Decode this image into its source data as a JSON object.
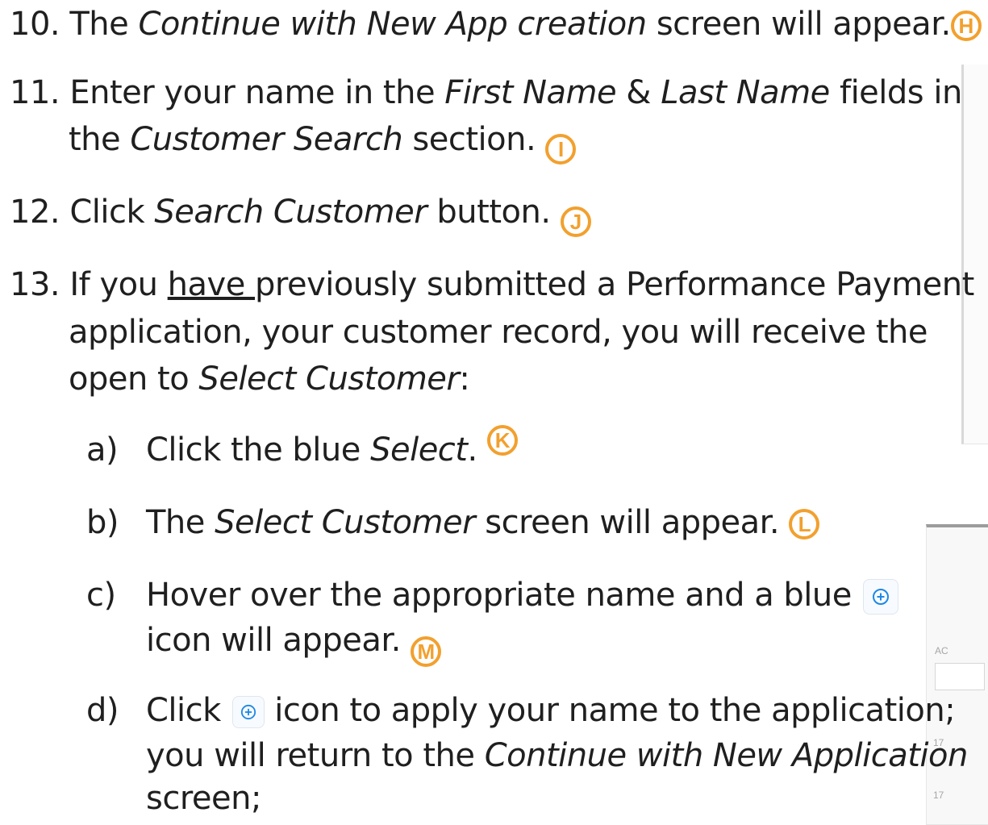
{
  "instructions": {
    "step10": {
      "number": "10.",
      "pre": "The ",
      "italic": "Continue with New App creation",
      "post": " screen will appear.",
      "marker": "H"
    },
    "step11": {
      "number": "11.",
      "line1_pre": "Enter your name in the ",
      "line1_italic1": "First Name",
      "line1_mid": " & ",
      "line1_italic2": "Last Name",
      "line1_post": " fields in",
      "line2_pre": "the ",
      "line2_italic": "Customer Search",
      "line2_post": " section.",
      "marker": "I"
    },
    "step12": {
      "number": "12.",
      "pre": "Click ",
      "italic": "Search Customer",
      "post": " button.",
      "marker": "J"
    },
    "step13": {
      "number": "13.",
      "line1_pre": "If you ",
      "line1_underline": "have ",
      "line1_post": "previously submitted a Performance Payment",
      "line2": "application, your customer record, you will receive the",
      "line3_pre": "open to ",
      "line3_italic": "Select Customer",
      "line3_post": ":"
    },
    "sub_a": {
      "letter": "a)",
      "pre": "Click the blue ",
      "italic": "Select",
      "post": ".",
      "marker": "K"
    },
    "sub_b": {
      "letter": "b)",
      "pre": "The ",
      "italic": "Select Customer",
      "post": " screen will appear.",
      "marker": "L"
    },
    "sub_c": {
      "letter": "c)",
      "line1": "Hover over the appropriate name and a blue",
      "line2": "icon will appear.",
      "marker": "M"
    },
    "sub_d": {
      "letter": "d)",
      "line1_pre": "Click",
      "line1_post": "icon to apply your name to the application;",
      "line2_pre": "you will return to the ",
      "line2_italic": "Continue with New Application",
      "line3": "screen;"
    }
  },
  "background_fragments": {
    "ac": "AC",
    "n1": "17",
    "n2": "17"
  },
  "colors": {
    "marker": "#f2a02e",
    "icon_blue": "#1e88e5",
    "text": "#1f1f1f"
  },
  "icons": {
    "add_icon": "circle-plus-icon"
  }
}
